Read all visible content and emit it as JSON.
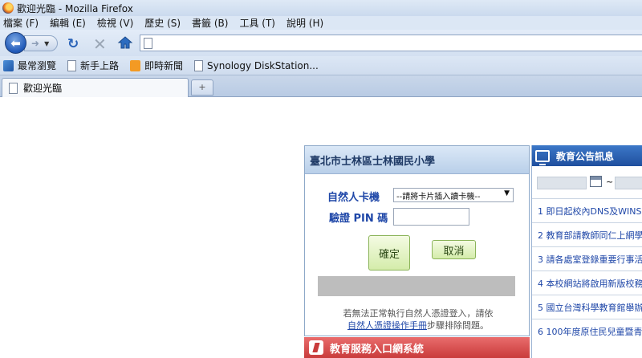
{
  "window": {
    "title": "歡迎光臨 - Mozilla Firefox"
  },
  "menu": [
    "檔案 (F)",
    "編輯 (E)",
    "檢視 (V)",
    "歷史 (S)",
    "書籤 (B)",
    "工具 (T)",
    "說明 (H)"
  ],
  "nav": {
    "url_value": "",
    "url_placeholder": ""
  },
  "bookmarks": [
    {
      "label": "最常瀏覽",
      "icon": "most-visited-icon"
    },
    {
      "label": "新手上路",
      "icon": "page-icon"
    },
    {
      "label": "即時新聞",
      "icon": "rss-icon"
    },
    {
      "label": "Synology DiskStation...",
      "icon": "page-icon"
    }
  ],
  "tabs": [
    {
      "label": "歡迎光臨"
    }
  ],
  "newtab_label": "+",
  "login": {
    "title": "臺北市士林區士林國民小學",
    "reader_label": "自然人卡機",
    "reader_selected": "--請將卡片插入讀卡機--",
    "pin_label": "驗證 PIN 碼",
    "pin_value": "",
    "ok_label": "確定",
    "cancel_label": "取消",
    "note_text": "若無法正常執行自然人憑證登入，請依",
    "note_link": "自然人憑證操作手冊",
    "note_suffix": "步驟排除問題。"
  },
  "service": {
    "title": "教育服務入口網系統"
  },
  "announcements": {
    "title": "教育公告訊息",
    "tilde": "~",
    "items": [
      "1 即日起校內DNS及WINS",
      "2 教育部請教師同仁上網學",
      "3 請各處室登錄重要行事活",
      "4 本校網站將啟用新版校務",
      "5 國立台灣科學教育館舉辦",
      "6 100年度原住民兒童暨青"
    ]
  }
}
